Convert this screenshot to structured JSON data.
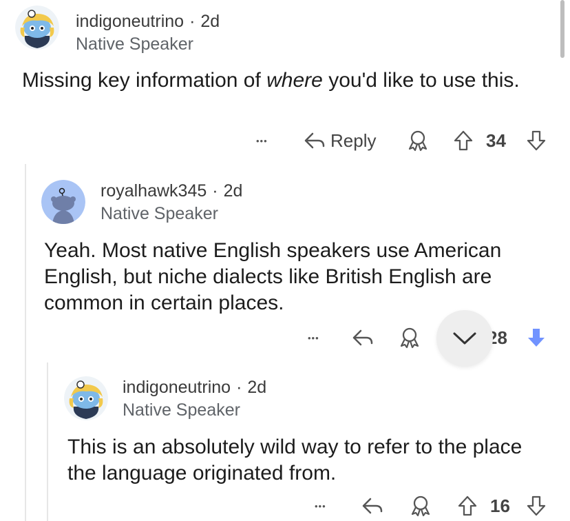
{
  "comments": [
    {
      "username": "indigoneutrino",
      "separator": "·",
      "age": "2d",
      "flair": "Native Speaker",
      "body_pre": "Missing key information of ",
      "body_em": "where",
      "body_post": " you'd like to use this.",
      "more": "•••",
      "reply_label": "Reply",
      "score": "34"
    },
    {
      "username": "royalhawk345",
      "separator": "·",
      "age": "2d",
      "flair": "Native Speaker",
      "body": "Yeah. Most native English speakers use American English, but niche dialects like British English are common in certain places.",
      "more": "•••",
      "score": "28",
      "downvote_color": "#7193ff"
    },
    {
      "username": "indigoneutrino",
      "separator": "·",
      "age": "2d",
      "flair": "Native Speaker",
      "body": "This is an absolutely wild way to refer to the place the language originated from.",
      "more": "•••",
      "score": "16"
    }
  ]
}
